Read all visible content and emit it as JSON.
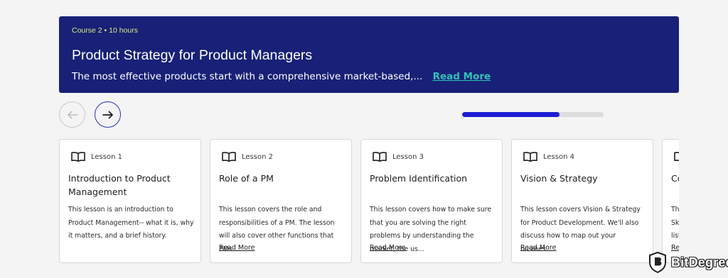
{
  "banner": {
    "meta": "Course 2 • 10 hours",
    "title": "Product Strategy for Product Managers",
    "description": "The most effective products start with a comprehensive market-based,...",
    "read_more": "Read More"
  },
  "carousel": {
    "prev_icon": "arrow-left-icon",
    "next_icon": "arrow-right-icon",
    "progress_fraction": 0.69
  },
  "lessons": [
    {
      "lesson": "Lesson 1",
      "title": "Introduction to Product Management",
      "description": "This lesson is an introduction to Product Management-- what it is, why it matters, and a brief history.",
      "read_more": ""
    },
    {
      "lesson": "Lesson 2",
      "title": "Role of a PM",
      "description": "This lesson covers the role and responsibilities of a PM. The lesson will also cover other functions that PMs...",
      "read_more": "Read More"
    },
    {
      "lesson": "Lesson 3",
      "title": "Problem Identification",
      "description": "This lesson covers how to make sure that you are solving the right problems by understanding the market, the us...",
      "read_more": "Read More"
    },
    {
      "lesson": "Lesson 4",
      "title": "Vision & Strategy",
      "description": "This lesson covers Vision & Strategy for Product Development. We'll also discuss how to map out your busines...",
      "read_more": "Read More"
    },
    {
      "lesson": "",
      "title": "Co",
      "description": "Thi Ski list",
      "read_more": "Re"
    }
  ],
  "watermark": {
    "text": "BitDegree",
    "icon": "bitdegree-shield-logo"
  },
  "colors": {
    "banner_bg": "#182177",
    "meta_text": "#d8ea7c",
    "link_teal": "#2ec4b6",
    "progress_fill": "#1d1ed4",
    "next_border": "#2a2fb8"
  }
}
